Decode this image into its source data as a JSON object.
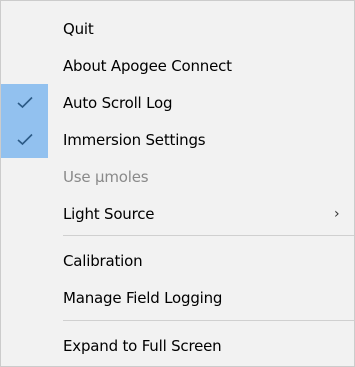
{
  "menu": {
    "items": [
      {
        "label": "Quit"
      },
      {
        "label": "About Apogee Connect"
      },
      {
        "label": "Auto Scroll Log",
        "checked": true
      },
      {
        "label": "Immersion Settings",
        "checked": true
      },
      {
        "label": "Use µmoles",
        "disabled": true
      },
      {
        "label": "Light Source",
        "submenu_arrow": "›"
      },
      {
        "label": "Calibration"
      },
      {
        "label": "Manage Field Logging"
      },
      {
        "label": "Expand to Full Screen"
      }
    ]
  },
  "colors": {
    "menu_background": "#f2f2f2",
    "check_highlight": "#92c1ef",
    "disabled_text": "#8a8a8a",
    "separator": "#d0d0d0"
  },
  "icons": {
    "check": "checkmark-icon",
    "submenu": "chevron-right-icon"
  }
}
